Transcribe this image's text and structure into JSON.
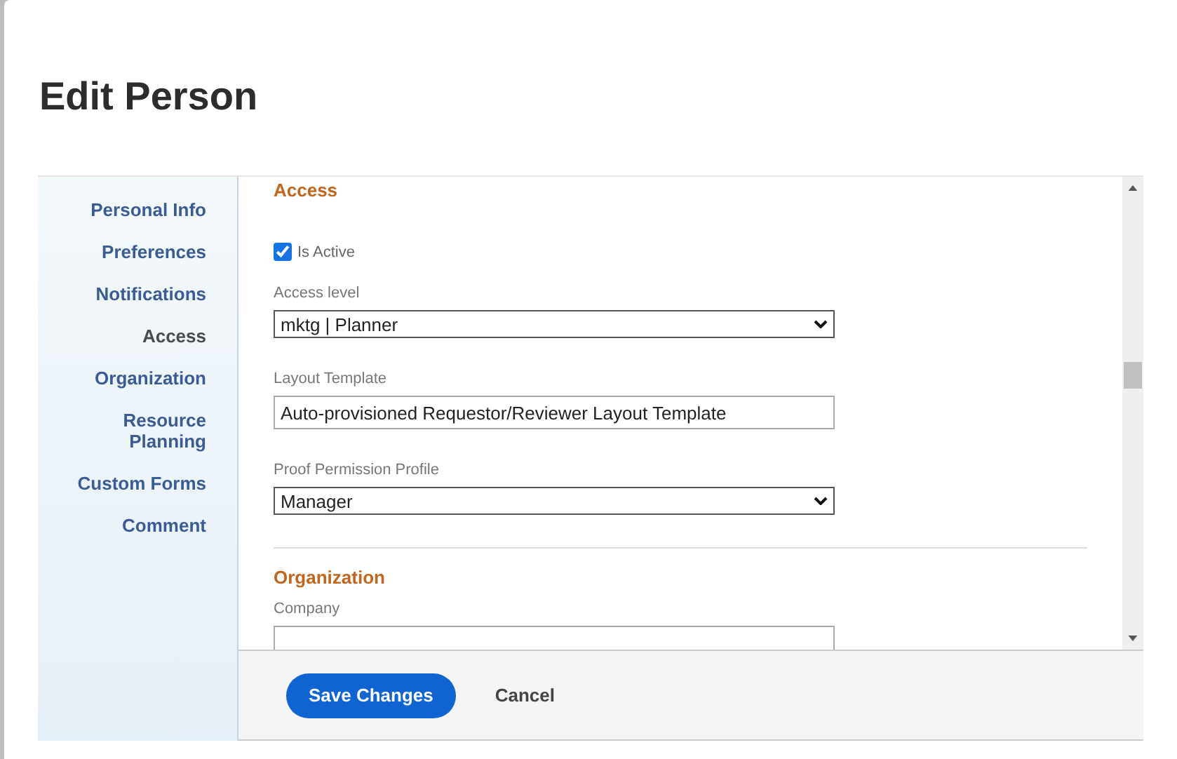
{
  "dialog": {
    "title": "Edit Person"
  },
  "nav": [
    {
      "label": "Personal Info",
      "selected": false
    },
    {
      "label": "Preferences",
      "selected": false
    },
    {
      "label": "Notifications",
      "selected": false
    },
    {
      "label": "Access",
      "selected": true
    },
    {
      "label": "Organization",
      "selected": false
    },
    {
      "label": "Resource Planning",
      "selected": false
    },
    {
      "label": "Custom Forms",
      "selected": false
    },
    {
      "label": "Comment",
      "selected": false
    }
  ],
  "access": {
    "heading": "Access",
    "is_active": {
      "label": "Is Active",
      "checked": true
    },
    "fields": [
      {
        "kind": "select",
        "label": "Access level",
        "value": "mktg | Planner"
      },
      {
        "kind": "text",
        "label": "Layout Template",
        "value": "Auto-provisioned Requestor/Reviewer Layout Template"
      },
      {
        "kind": "select",
        "label": "Proof Permission Profile",
        "value": "Manager"
      }
    ]
  },
  "organization": {
    "heading": "Organization",
    "fields": [
      {
        "kind": "text",
        "label": "Company"
      }
    ]
  },
  "footer": {
    "save": "Save Changes",
    "cancel": "Cancel"
  }
}
